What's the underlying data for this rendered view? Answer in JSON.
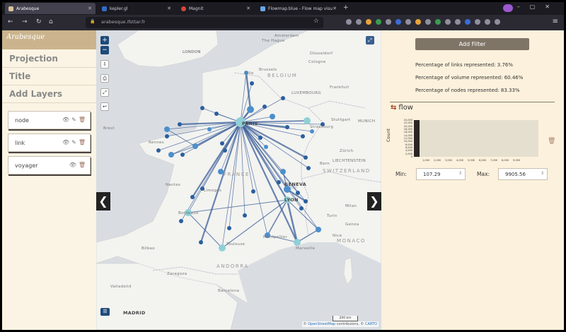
{
  "browser": {
    "tabs": [
      {
        "title": "Arabesque",
        "active": true
      },
      {
        "title": "kepler.gl",
        "active": false
      },
      {
        "title": "Magnit",
        "active": false
      },
      {
        "title": "Flowmap.blue - Flow map visu",
        "active": false
      }
    ],
    "url": "arabesque.ifsttar.fr"
  },
  "sidebar": {
    "logo": "Arabesque",
    "menu": [
      "Projection",
      "Title",
      "Add Layers"
    ],
    "layers": [
      {
        "name": "node"
      },
      {
        "name": "link"
      },
      {
        "name": "voyager"
      }
    ]
  },
  "map": {
    "labels": {
      "london": "LONDON",
      "belgium": "BELGIUM",
      "brussels": "Brussels",
      "lille": "Lille",
      "luxembourg": "LUXEMBOURG",
      "paris": "PARIS",
      "strasbourg": "Strasbourg",
      "france": "FRANCE",
      "switzerland": "SWITZERLAND",
      "geneva": "GENEVA",
      "lyon": "LYON",
      "bordeaux": "Bordeaux",
      "toulouse": "Toulouse",
      "marseille": "Marseille",
      "nice": "Nice",
      "montpellier": "Montpellier",
      "andorra": "ANDORRA",
      "monaco": "MONACO",
      "madrid": "MADRID",
      "barcelona": "Barcelona",
      "milan": "Milan",
      "turin": "Turin",
      "genoa": "Genoa",
      "zurich": "Zürich",
      "bern": "Bern",
      "frankfurt": "Frankfurt",
      "stuttgart": "Stuttgart",
      "munich": "MUNICH",
      "nantes": "Nantes",
      "rennes": "Rennes",
      "brest": "Brest",
      "limoges": "Limoges",
      "amsterdam": "Amsterdam",
      "hague": "The Hague",
      "cologne": "Cologne",
      "dusseldorf": "Düsseldorf",
      "bilbao": "Bilbao",
      "zaragoza": "Zaragoza",
      "valladolid": "Valladolid",
      "liechtenstein": "LIECHTENSTEIN"
    },
    "scale": "200 km",
    "attribution_prefix": "©",
    "attribution_osm": "OpenStreetMap",
    "attribution_mid": "contributors, ©",
    "attribution_carto": "CARTO"
  },
  "filters": {
    "add_filter_label": "Add Filter",
    "stats": [
      "Percentage of links represented: 3.76%",
      "Percentage of volume represented: 60.46%",
      "Percentage of nodes represented: 83.33%"
    ],
    "flow": {
      "title": "flow",
      "ylabel": "Count",
      "yticks": [
        "24,000",
        "22,000",
        "20,000",
        "18,000",
        "16,000",
        "14,000",
        "12,000",
        "10,000",
        "8,000",
        "6,000",
        "4,000",
        "2,000",
        "0"
      ],
      "xticks": [
        "1,000",
        "2,000",
        "3,000",
        "4,000",
        "5,000",
        "6,000",
        "7,000",
        "8,000",
        "9,000"
      ],
      "min_label": "Min:",
      "min_value": "107.29",
      "max_label": "Max:",
      "max_value": "9905.56"
    }
  },
  "colors": {
    "node_light": "#8fd0d6",
    "node_mid": "#4b8fcc",
    "node_dark": "#2a5f9e",
    "link": "#3b5f99",
    "sidebar_header": "#cbb48d",
    "add_filter_bg": "#7f7567"
  }
}
